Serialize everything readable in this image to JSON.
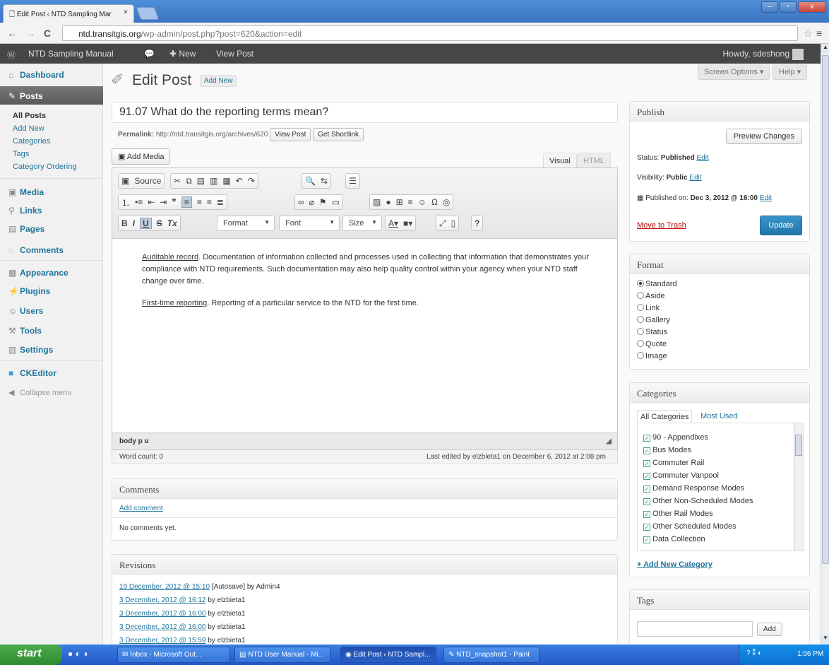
{
  "browser": {
    "tab_title": "Edit Post ‹ NTD Sampling Mar",
    "tab_close": "×",
    "url_host": "ntd.transitgis.org",
    "url_path": "/wp-admin/post.php?post=620&action=edit"
  },
  "adminbar": {
    "site_name": "NTD Sampling Manual",
    "new_label": "New",
    "view_post": "View Post",
    "howdy": "Howdy, sdeshong"
  },
  "sidebar": {
    "dashboard": "Dashboard",
    "posts": "Posts",
    "sub": [
      "All Posts",
      "Add New",
      "Categories",
      "Tags",
      "Category Ordering"
    ],
    "media": "Media",
    "links": "Links",
    "pages": "Pages",
    "comments": "Comments",
    "appearance": "Appearance",
    "plugins": "Plugins",
    "users": "Users",
    "tools": "Tools",
    "settings": "Settings",
    "ckeditor": "CKEditor",
    "collapse": "Collapse menu"
  },
  "header": {
    "title": "Edit Post",
    "add_new": "Add New",
    "screen_options": "Screen Options ▾",
    "help": "Help ▾"
  },
  "post": {
    "title": "91.07       What do the reporting terms mean?",
    "permalink_label": "Permalink:",
    "permalink_url": "http://ntd.transitgis.org/archives/620",
    "view_post_btn": "View Post",
    "shortlink_btn": "Get Shortlink",
    "add_media": "Add Media",
    "tab_visual": "Visual",
    "tab_html": "HTML"
  },
  "toolbar": {
    "source": "Source",
    "format": "Format",
    "font": "Font",
    "size": "Size"
  },
  "content": {
    "p1_term": "Auditable record",
    "p1_text": ".  Documentation of information collected and processes used in collecting that information that demonstrates your compliance with NTD requirements. Such documentation may also help quality control within your agency when your NTD staff change over time.",
    "p2_term": "First-time reporting",
    "p2_text": ".  Reporting of a particular service to the NTD for the first time."
  },
  "editor_status": {
    "path": "body  p  u",
    "word_count": "Word count: 0",
    "last_edited": "Last edited by elzbieta1 on December 6, 2012 at 2:08 pm"
  },
  "comments": {
    "heading": "Comments",
    "add": "Add comment",
    "none": "No comments yet."
  },
  "revisions": {
    "heading": "Revisions",
    "items": [
      {
        "date": "19 December, 2012 @ 15:10",
        "by": " [Autosave] by Admin4"
      },
      {
        "date": "3 December, 2012 @ 16:12",
        "by": " by elzbieta1"
      },
      {
        "date": "3 December, 2012 @ 16:00",
        "by": " by elzbieta1"
      },
      {
        "date": "3 December, 2012 @ 16:00",
        "by": " by elzbieta1"
      },
      {
        "date": "3 December, 2012 @ 15:59",
        "by": " by elzbieta1"
      }
    ]
  },
  "publish": {
    "heading": "Publish",
    "preview": "Preview Changes",
    "status_label": "Status:",
    "status_value": "Published",
    "visibility_label": "Visibility:",
    "visibility_value": "Public",
    "published_on_label": "Published on:",
    "published_on_value": "Dec 3, 2012 @ 16:00",
    "edit": "Edit",
    "trash": "Move to Trash",
    "update": "Update"
  },
  "format": {
    "heading": "Format",
    "options": [
      "Standard",
      "Aside",
      "Link",
      "Gallery",
      "Status",
      "Quote",
      "Image"
    ],
    "selected": "Standard"
  },
  "categories": {
    "heading": "Categories",
    "tab_all": "All Categories",
    "tab_most": "Most Used",
    "items": [
      "90 - Appendixes",
      "Bus Modes",
      "Commuter Rail",
      "Commuter Vanpool",
      "Demand Response Modes",
      "Other Non-Scheduled Modes",
      "Other Rail Modes",
      "Other Scheduled Modes",
      "Data Collection"
    ],
    "add_new": "+ Add New Category"
  },
  "tags": {
    "heading": "Tags",
    "add": "Add"
  },
  "taskbar": {
    "start": "start",
    "tasks": [
      "Inbox - Microsoft Out...",
      "NTD User Manual - Mi...",
      "Edit Post ‹ NTD Sampl...",
      "NTD_snapshot1 - Paint"
    ],
    "clock": "1:06 PM"
  }
}
